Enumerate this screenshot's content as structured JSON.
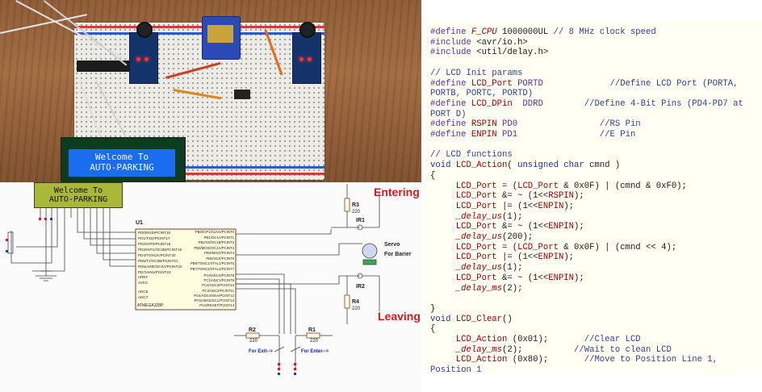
{
  "photo": {
    "lcd_line1": "Welcome To",
    "lcd_line2": "AUTO-PARKING"
  },
  "schematic": {
    "lcd_line1": "Welcome To",
    "lcd_line2": "AUTO-PARKING",
    "entering_label": "Entering",
    "leaving_label": "Leaving",
    "u1_label": "U1",
    "mcu_name": "ATMEGA328P",
    "r3": "R3",
    "r3_val": "220",
    "r4": "R4",
    "r4_val": "220",
    "r1": "R1",
    "r1_val": "220",
    "r2": "R2",
    "r2_val": "220",
    "ir1": "IR1",
    "ir2": "IR2",
    "servo": "Servo",
    "barrier": "For Barier",
    "exit": "For Exit-->",
    "enter": "For Enter-->",
    "pins_left": [
      "PD0/RXD/PCINT16",
      "PD1/TXD/PCINT17",
      "PD2/INT0/PCINT18",
      "PD3/INT1/OC2B/PCINT19",
      "PD4/T0/XCK/PCINT20",
      "PD5/T1/OC0B/PCINT21",
      "PD6/AIN0/OC0A/PCINT22",
      "PD7/AIN1/PCINT23"
    ],
    "pins_left2": [
      "AREF",
      "AVCC",
      "ADC6",
      "ADC7"
    ],
    "pins_right": [
      "PB0/ICP1/CLKO/PCINT0",
      "PB1/OC1A/PCINT1",
      "PB2/SS/OC1B/PCINT2",
      "PB3/MOSI/OC2A/PCINT3",
      "PB4/MISO/PCINT4",
      "PB5/SCK/PCINT5",
      "PB6/TOSC1/XTAL1/PCINT6",
      "PB7/TOSC2/XTAL2/PCINT7"
    ],
    "pins_right2": [
      "PC0/ADC0/PCINT8",
      "PC1/ADC1/PCINT9",
      "PC2/ADC2/PCINT10",
      "PC3/ADC3/PCINT11",
      "PC4/ADC4/SDA/PCINT12",
      "PC5/ADC5/SCL/PCINT13",
      "PC6/RESET/PCINT14"
    ]
  },
  "code": {
    "lines": [
      [
        [
          "macro",
          "#define "
        ],
        [
          "it",
          "F_CPU"
        ],
        [
          "pl",
          " 1000000UL "
        ],
        [
          "cm",
          "// 8 MHz clock speed"
        ]
      ],
      [
        [
          "macro",
          "#include "
        ],
        [
          "pl",
          "<avr/io.h>"
        ]
      ],
      [
        [
          "macro",
          "#include "
        ],
        [
          "pl",
          "<util/delay.h>"
        ]
      ],
      [],
      [
        [
          "cm",
          "// LCD Init params"
        ]
      ],
      [
        [
          "macro",
          "#define "
        ],
        [
          "fn",
          "LCD_Port"
        ],
        [
          "macro",
          " PORTD"
        ],
        [
          "cm",
          "             //Define LCD Port (PORTA,"
        ]
      ],
      [
        [
          "cm",
          "PORTB, PORTC, PORTD)"
        ]
      ],
      [
        [
          "macro",
          "#define "
        ],
        [
          "fn",
          "LCD_DPin"
        ],
        [
          "macro",
          "  DDRD"
        ],
        [
          "cm",
          "        //Define 4-Bit Pins (PD4-PD7 at"
        ]
      ],
      [
        [
          "cm",
          "PORT D)"
        ]
      ],
      [
        [
          "macro",
          "#define "
        ],
        [
          "fn",
          "RSPIN"
        ],
        [
          "macro",
          " PD0"
        ],
        [
          "cm",
          "                //RS Pin"
        ]
      ],
      [
        [
          "macro",
          "#define "
        ],
        [
          "fn",
          "ENPIN"
        ],
        [
          "macro",
          " PD1"
        ],
        [
          "cm",
          "                //E Pin"
        ]
      ],
      [],
      [
        [
          "cm",
          "// LCD functions"
        ]
      ],
      [
        [
          "kw",
          "void "
        ],
        [
          "fn",
          "LCD_Action"
        ],
        [
          "pl",
          "( "
        ],
        [
          "kw",
          "unsigned char"
        ],
        [
          "pl",
          " cmnd )"
        ]
      ],
      [
        [
          "pl",
          "{"
        ]
      ],
      [
        [
          "pl",
          "     "
        ],
        [
          "fn",
          "LCD_Port"
        ],
        [
          "pl",
          " = ("
        ],
        [
          "fn",
          "LCD_Port"
        ],
        [
          "pl",
          " & 0x0F) | (cmnd & 0xF0);"
        ]
      ],
      [
        [
          "pl",
          "     "
        ],
        [
          "fn",
          "LCD_Port"
        ],
        [
          "pl",
          " &= ~ (1<<"
        ],
        [
          "fn",
          "RSPIN"
        ],
        [
          "pl",
          ");"
        ]
      ],
      [
        [
          "pl",
          "     "
        ],
        [
          "fn",
          "LCD_Port"
        ],
        [
          "pl",
          " |= (1<<"
        ],
        [
          "fn",
          "ENPIN"
        ],
        [
          "pl",
          ");"
        ]
      ],
      [
        [
          "pl",
          "     "
        ],
        [
          "it",
          "_delay_us"
        ],
        [
          "pl",
          "(1);"
        ]
      ],
      [
        [
          "pl",
          "     "
        ],
        [
          "fn",
          "LCD_Port"
        ],
        [
          "pl",
          " &= ~ (1<<"
        ],
        [
          "fn",
          "ENPIN"
        ],
        [
          "pl",
          ");"
        ]
      ],
      [
        [
          "pl",
          "     "
        ],
        [
          "it",
          "_delay_us"
        ],
        [
          "pl",
          "(200);"
        ]
      ],
      [
        [
          "pl",
          "     "
        ],
        [
          "fn",
          "LCD_Port"
        ],
        [
          "pl",
          " = ("
        ],
        [
          "fn",
          "LCD_Port"
        ],
        [
          "pl",
          " & 0x0F) | (cmnd << 4);"
        ]
      ],
      [
        [
          "pl",
          "     "
        ],
        [
          "fn",
          "LCD_Port"
        ],
        [
          "pl",
          " |= (1<<"
        ],
        [
          "fn",
          "ENPIN"
        ],
        [
          "pl",
          ");"
        ]
      ],
      [
        [
          "pl",
          "     "
        ],
        [
          "it",
          "_delay_us"
        ],
        [
          "pl",
          "(1);"
        ]
      ],
      [
        [
          "pl",
          "     "
        ],
        [
          "fn",
          "LCD_Port"
        ],
        [
          "pl",
          " &= ~ (1<<"
        ],
        [
          "fn",
          "ENPIN"
        ],
        [
          "pl",
          ");"
        ]
      ],
      [
        [
          "pl",
          "     "
        ],
        [
          "it",
          "_delay_ms"
        ],
        [
          "pl",
          "(2);"
        ]
      ],
      [],
      [
        [
          "pl",
          "}"
        ]
      ],
      [
        [
          "kw",
          "void "
        ],
        [
          "fn",
          "LCD_Clear"
        ],
        [
          "pl",
          "()"
        ]
      ],
      [
        [
          "pl",
          "{"
        ]
      ],
      [
        [
          "pl",
          "     "
        ],
        [
          "fn",
          "LCD_Action"
        ],
        [
          "pl",
          " (0x01);       "
        ],
        [
          "cm",
          "//Clear LCD"
        ]
      ],
      [
        [
          "pl",
          "     "
        ],
        [
          "it",
          "_delay_ms"
        ],
        [
          "pl",
          "(2);          "
        ],
        [
          "cm",
          "//Wait to clean LCD"
        ]
      ],
      [
        [
          "pl",
          "     "
        ],
        [
          "fn",
          "LCD_Action"
        ],
        [
          "pl",
          " (0x80);       "
        ],
        [
          "cm",
          "//Move to Position Line 1,"
        ]
      ],
      [
        [
          "cm",
          "Position 1"
        ]
      ]
    ]
  }
}
